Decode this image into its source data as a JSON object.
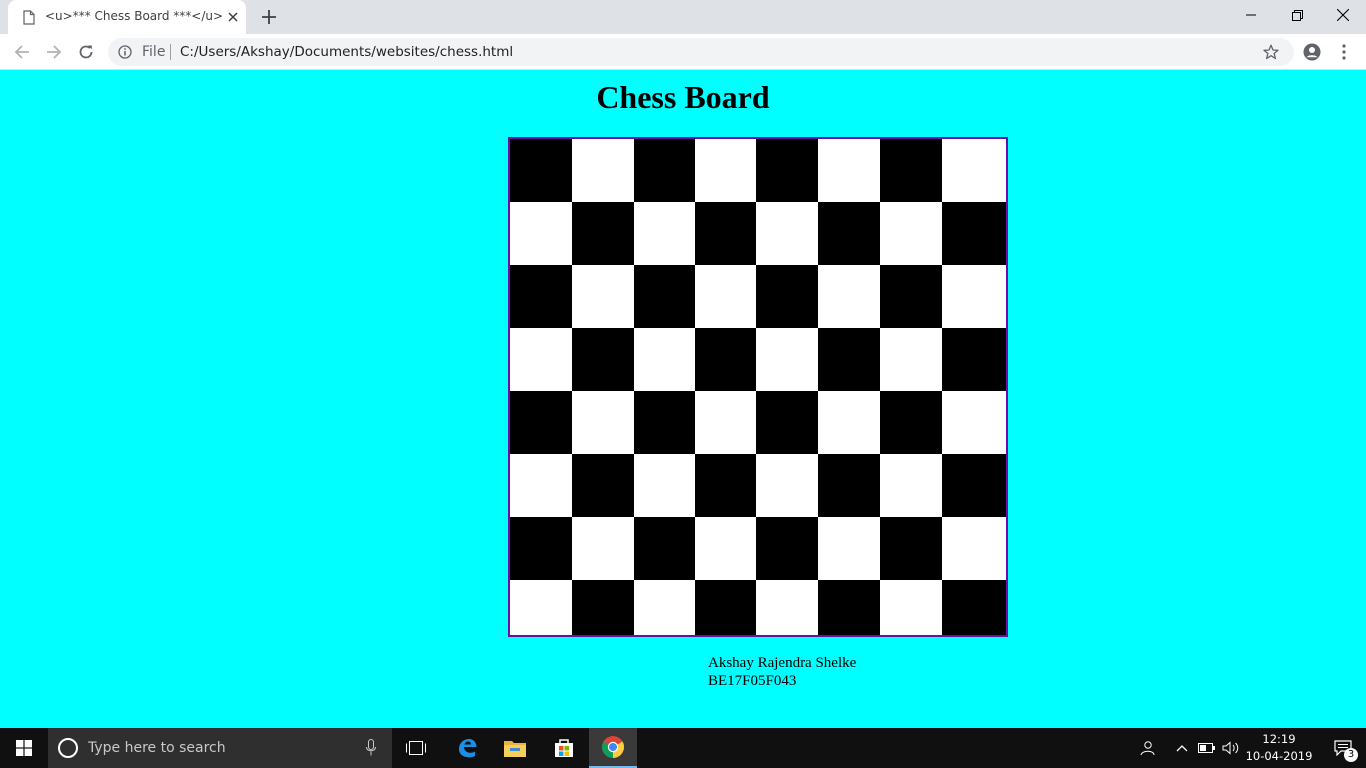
{
  "browser": {
    "tab_title": "<u>*** Chess Board ***</u>",
    "address": {
      "scheme_label": "File",
      "url": "C:/Users/Akshay/Documents/websites/chess.html"
    }
  },
  "page": {
    "heading": "Chess Board",
    "board": {
      "rows": 8,
      "cols": 8,
      "top_left_color": "black",
      "dark_color": "#000000",
      "light_color": "#ffffff",
      "border_color": "#6a0dad"
    },
    "credits": {
      "name": "Akshay Rajendra Shelke",
      "id": "BE17F05F043"
    },
    "background_color": "#00ffff"
  },
  "taskbar": {
    "search_placeholder": "Type here to search",
    "apps": [
      "task-view-icon",
      "edge-icon",
      "file-explorer-icon",
      "store-icon",
      "chrome-icon"
    ],
    "active_app": "chrome-icon",
    "clock": {
      "time": "12:19",
      "date": "10-04-2019"
    },
    "notification_count": "3"
  }
}
